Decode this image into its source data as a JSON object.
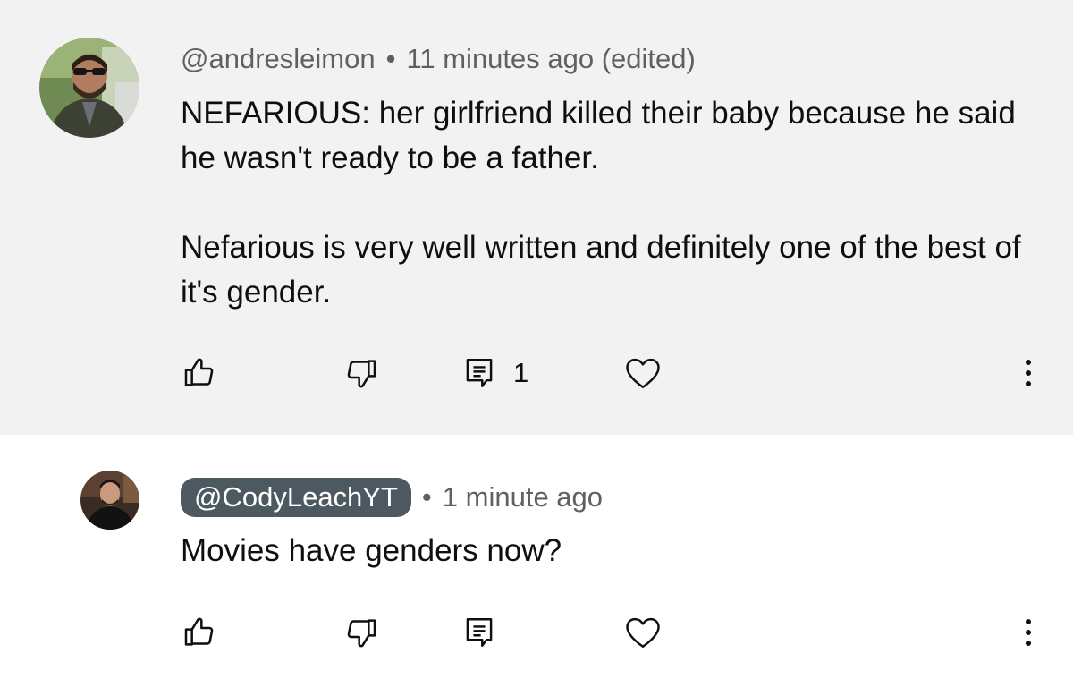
{
  "comments": [
    {
      "handle": "@andresleimon",
      "separator": "•",
      "time": "11 minutes ago (edited)",
      "paragraphs": [
        "NEFARIOUS: her girlfriend killed their baby because he said he wasn't ready to be a father.",
        "Nefarious is very well written and definitely one of the best of it's gender."
      ],
      "reply_count": "1",
      "highlighted": true,
      "avatar": "man-with-sunglasses-photo"
    },
    {
      "handle": "@CodyLeachYT",
      "separator": "•",
      "time": "1 minute ago",
      "paragraphs": [
        "Movies have genders now?"
      ],
      "reply_count": "",
      "handle_badge": true,
      "avatar": "man-in-dark-shirt-photo"
    }
  ],
  "icons": {
    "like": "thumbs-up-icon",
    "dislike": "thumbs-down-icon",
    "reply": "comment-icon",
    "heart": "heart-icon",
    "more": "more-vertical-icon"
  },
  "colors": {
    "highlight_bg": "#f2f2f2",
    "badge_bg": "#4d5960",
    "meta_text": "#606060",
    "body_text": "#0f0f0f"
  }
}
